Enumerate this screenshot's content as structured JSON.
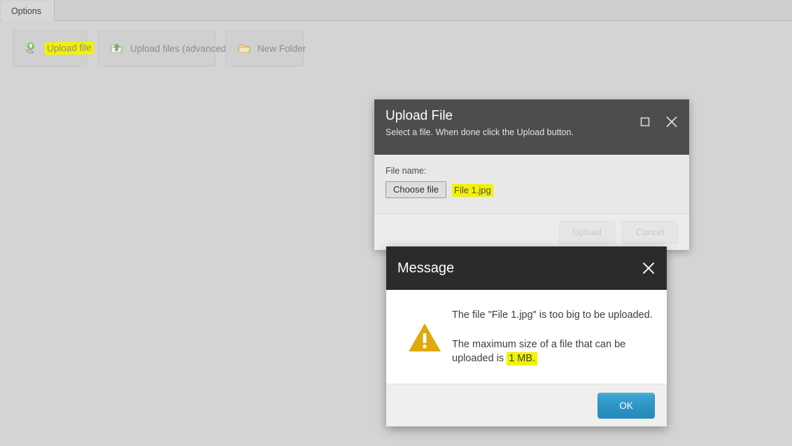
{
  "tabstrip": {
    "tabs": [
      {
        "label": "Options"
      }
    ]
  },
  "toolbar": {
    "buttons": [
      {
        "label": "Upload file",
        "icon": "upload-file-icon",
        "highlighted": true
      },
      {
        "label": "Upload files (advanced)",
        "icon": "upload-folder-icon",
        "highlighted": false
      },
      {
        "label": "New Folder",
        "icon": "new-folder-icon",
        "highlighted": false
      }
    ]
  },
  "upload_dialog": {
    "title": "Upload File",
    "subtitle": "Select a file. When done click the Upload button.",
    "maximize_icon": "maximize-icon",
    "close_icon": "close-icon",
    "filename_label": "File name:",
    "choose_file_label": "Choose file",
    "chosen_filename": "File 1.jpg",
    "footer": {
      "upload_label": "Upload",
      "cancel_label": "Cancel",
      "upload_enabled": false,
      "cancel_enabled": false
    }
  },
  "message_dialog": {
    "title": "Message",
    "close_icon": "close-icon",
    "warning_icon": "warning-triangle-icon",
    "line_1": "The file \"File 1.jpg\" is too big to be uploaded.",
    "line_2_prefix": "The maximum size of a file that can be uploaded is ",
    "line_2_highlight": "1 MB.",
    "ok_label": "OK"
  },
  "colors": {
    "page_background": "#d4d4d4",
    "upload_titlebar": "#4d4d4d",
    "message_titlebar": "#2b2b2b",
    "highlight_marker": "#f2f200",
    "warning_amber": "#e0a80c",
    "ok_button_blue": "#2e94c4"
  }
}
